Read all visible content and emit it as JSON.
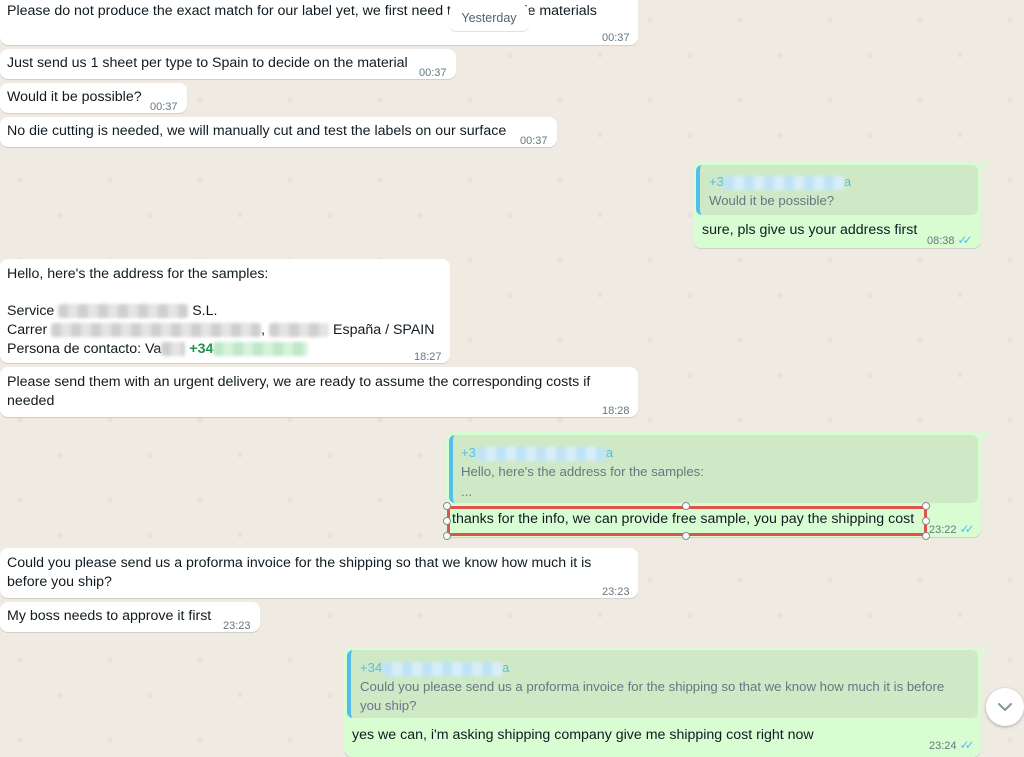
{
  "date_chip": "Yesterday",
  "messages": [
    {
      "id": "m1",
      "dir": "in",
      "text": "Please do not produce the exact match for our label yet, we first need to see sample materials",
      "time": "00:37"
    },
    {
      "id": "m2",
      "dir": "in",
      "text": "Just send us 1 sheet per type to Spain to decide on the material",
      "time": "00:37"
    },
    {
      "id": "m3",
      "dir": "in",
      "text": "Would it be possible?",
      "time": "00:37"
    },
    {
      "id": "m4",
      "dir": "in",
      "text": "No die cutting is needed, we will manually cut and test the labels on our surface",
      "time": "00:37"
    },
    {
      "id": "m5",
      "dir": "out",
      "quote_name": "+3",
      "quote_name_suffix": "a",
      "quote_text": "Would it be possible?",
      "text": "sure, pls give us your address first",
      "time": "08:38",
      "ticks": "✓✓"
    },
    {
      "id": "m6",
      "dir": "in",
      "lines": [
        "Hello, here's the address for the samples:",
        "",
        "Service",
        "S.L.",
        "Carrer",
        ",",
        "España / SPAIN",
        "Persona de contacto: Va",
        "+34"
      ],
      "time": "18:27"
    },
    {
      "id": "m7",
      "dir": "in",
      "lines": [
        "Please send them with an urgent delivery, we are ready to assume the corresponding costs if",
        "needed"
      ],
      "time": "18:28"
    },
    {
      "id": "m8",
      "dir": "out",
      "quote_name": "+3",
      "quote_name_suffix": "a",
      "quote_lines": [
        "Hello, here's the address for the samples:",
        "..."
      ],
      "text": "thanks for the info, we can provide free sample, you pay the shipping cost",
      "time": "23:22",
      "ticks": "✓✓"
    },
    {
      "id": "m9",
      "dir": "in",
      "lines": [
        "Could you please send us a proforma invoice for the shipping so that we know how much it is",
        "before you ship?"
      ],
      "time": "23:23"
    },
    {
      "id": "m10",
      "dir": "in",
      "text": "My boss needs to approve it first",
      "time": "23:23"
    },
    {
      "id": "m11",
      "dir": "out",
      "quote_name": "+34",
      "quote_name_suffix": "a",
      "quote_lines": [
        "Could you please send us a proforma invoice for the shipping so that we know how much it is before",
        "you ship?"
      ],
      "text": "yes we can, i'm asking shipping company give me shipping cost right now",
      "time": "23:24",
      "ticks": "✓✓"
    }
  ],
  "colors": {
    "incoming": "#ffffff",
    "outgoing": "#d9fdd3",
    "quote_bar": "#53bdeb",
    "selection": "#e0524a",
    "phone": "#1f8f4e"
  },
  "icons": {
    "scroll_down": "chevron-down-icon",
    "read_receipt": "double-check-icon"
  }
}
